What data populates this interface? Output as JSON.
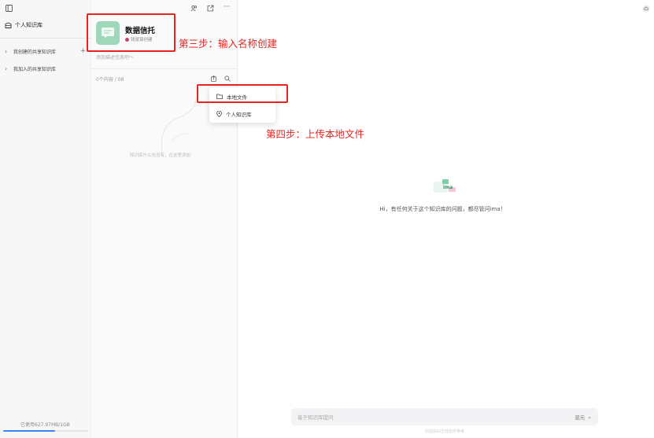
{
  "sidebar": {
    "title": "个人知识库",
    "items": [
      {
        "label": "我创建的共享知识库"
      },
      {
        "label": "我加入的共享知识库"
      }
    ],
    "storage_text": "已使用627.97MB/1GB",
    "storage_progress": 0.61
  },
  "kb": {
    "name": "数据信托",
    "subtitle": "钱鼠锦创建",
    "description": "添加描述信息吧～",
    "count_text": "0个内容 / 0B",
    "empty_text": "知识库什么也没有，在这里添加",
    "colors": {
      "card_bg": "#9fd7bb",
      "card_fg": "#ffffff"
    }
  },
  "menu": {
    "items": [
      {
        "label": "本地文件",
        "icon": "folder-icon"
      },
      {
        "label": "个人知识库",
        "icon": "location-pin-icon"
      }
    ]
  },
  "chat": {
    "greeting": "Hi，有任何关于这个知识库的问题，都尽管问ima！",
    "placeholder": "基于知识库提问",
    "mode_label": "混元",
    "footer": "内容由AI生成仅供参考",
    "logo_text": "ima"
  },
  "annotations": {
    "step3": "第三步：输入名称创建",
    "step4": "第四步：上传本地文件",
    "color": "#e5231f"
  }
}
